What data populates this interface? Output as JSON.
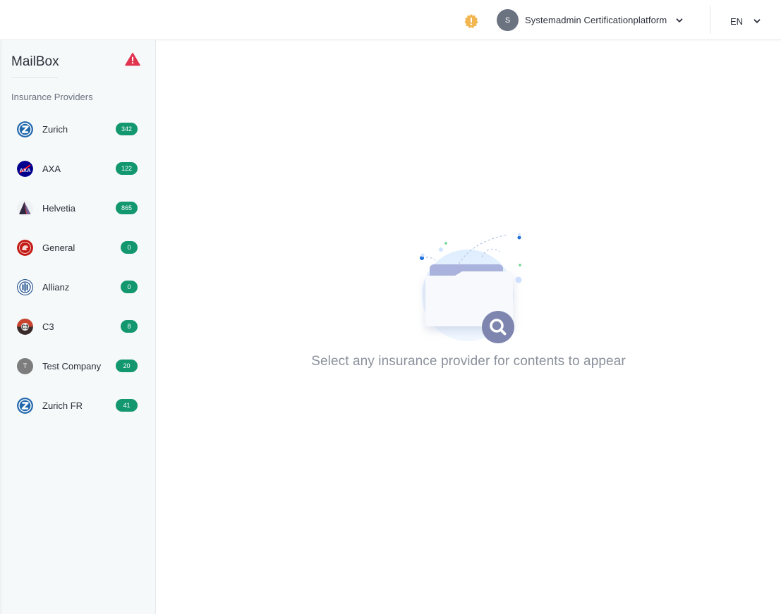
{
  "header": {
    "notification_icon": "exclamation-badge-icon",
    "user": {
      "initial": "S",
      "name": "Systemadmin Certificationplatform"
    },
    "language": "EN"
  },
  "sidebar": {
    "title": "MailBox",
    "alert_icon": "warning-triangle-icon",
    "section_label": "Insurance Providers",
    "providers": [
      {
        "name": "Zurich",
        "count": "342",
        "logo": "zurich-logo"
      },
      {
        "name": "AXA",
        "count": "122",
        "logo": "axa-logo"
      },
      {
        "name": "Helvetia",
        "count": "865",
        "logo": "helvetia-logo"
      },
      {
        "name": "General",
        "count": "0",
        "logo": "generali-lion-logo"
      },
      {
        "name": "Allianz",
        "count": "0",
        "logo": "allianz-logo"
      },
      {
        "name": "C3",
        "count": "8",
        "logo": "c3-logo"
      },
      {
        "name": "Test Company",
        "count": "20",
        "logo": "initial-avatar",
        "initial": "T"
      },
      {
        "name": "Zurich FR",
        "count": "41",
        "logo": "zurich-logo"
      }
    ]
  },
  "main": {
    "empty_icon": "folder-search-illustration",
    "empty_message": "Select any insurance provider for contents to appear"
  },
  "colors": {
    "badge": "#12976f",
    "warning": "#e0344f",
    "notification": "#f2b650",
    "avatar": "#6b7280"
  }
}
